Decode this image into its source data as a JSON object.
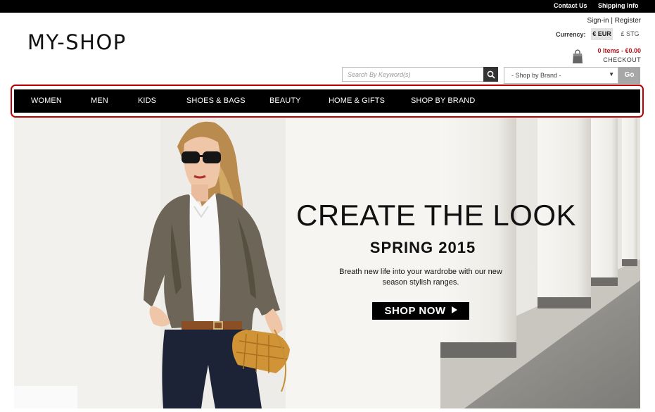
{
  "topbar": {
    "contact": "Contact Us",
    "shipping": "Shipping Info"
  },
  "logo": "MY-SHOP",
  "account": {
    "signin": "Sign-in",
    "separator": " | ",
    "register": "Register"
  },
  "currency": {
    "label": "Currency:",
    "eur": "€ EUR",
    "stg": "£ STG"
  },
  "cart": {
    "items": "0 Items - €0.00",
    "checkout": "CHECKOUT"
  },
  "search": {
    "placeholder": "Search By Keyword(s)"
  },
  "brand_select": {
    "value": "- Shop by Brand -",
    "go": "Go"
  },
  "nav": [
    "WOMEN",
    "MEN",
    "KIDS",
    "SHOES & BAGS",
    "BEAUTY",
    "HOME & GIFTS",
    "SHOP BY BRAND"
  ],
  "hero": {
    "title": "CREATE THE LOOK",
    "subtitle": "SPRING 2015",
    "description": "Breath new life into your wardrobe with our new season stylish ranges.",
    "cta": "SHOP NOW"
  },
  "colors": {
    "accent_red": "#b5121b",
    "nav_bg": "#000000",
    "outline": "#c00000"
  }
}
